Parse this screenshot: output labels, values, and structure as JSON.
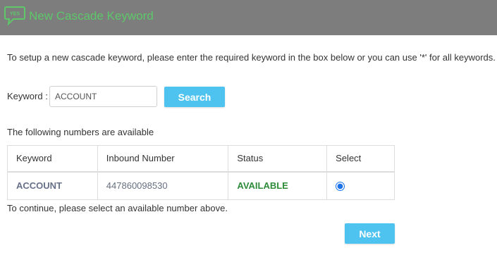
{
  "header": {
    "logo_text": "YES",
    "title": "New Cascade Keyword",
    "title_color": "#5ec76a",
    "background": "#7d7d7d"
  },
  "intro_text": "To setup a new cascade keyword, please enter the required keyword in the box below or you can use '*' for all keywords.",
  "search": {
    "label": "Keyword :",
    "value": "ACCOUNT",
    "button_label": "Search",
    "button_color": "#4fc3ef"
  },
  "available_text": "The following numbers are available",
  "table": {
    "headers": [
      "Keyword",
      "Inbound Number",
      "Status",
      "Select"
    ],
    "rows": [
      {
        "keyword": "ACCOUNT",
        "number": "447860098530",
        "status": "AVAILABLE",
        "selected": true
      }
    ]
  },
  "continue_text": "To continue, please select an available number above.",
  "next_label": "Next"
}
